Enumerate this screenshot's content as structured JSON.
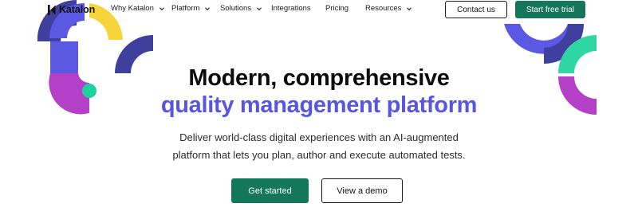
{
  "brand": {
    "name": "Katalon",
    "colors": {
      "primary_green": "#15775a",
      "accent_purple": "#5855de",
      "deco_indigo": "#3f3f9e",
      "deco_violet": "#5b59e3",
      "deco_yellow": "#f8d43c",
      "deco_magenta": "#b540c8",
      "deco_teal": "#2fd6a3"
    }
  },
  "nav": {
    "items": [
      {
        "label": "Why Katalon",
        "has_dropdown": true
      },
      {
        "label": "Platform",
        "has_dropdown": true
      },
      {
        "label": "Solutions",
        "has_dropdown": true
      },
      {
        "label": "Integrations",
        "has_dropdown": false
      },
      {
        "label": "Pricing",
        "has_dropdown": false
      },
      {
        "label": "Resources",
        "has_dropdown": true
      }
    ],
    "contact_label": "Contact us",
    "trial_label": "Start free trial"
  },
  "hero": {
    "title_line1": "Modern, comprehensive",
    "title_line2": "quality management platform",
    "subtitle_line1": "Deliver world-class digital experiences with an AI-augmented",
    "subtitle_line2": "platform that lets you plan, author and execute automated tests.",
    "primary_cta": "Get started",
    "secondary_cta": "View a demo"
  }
}
